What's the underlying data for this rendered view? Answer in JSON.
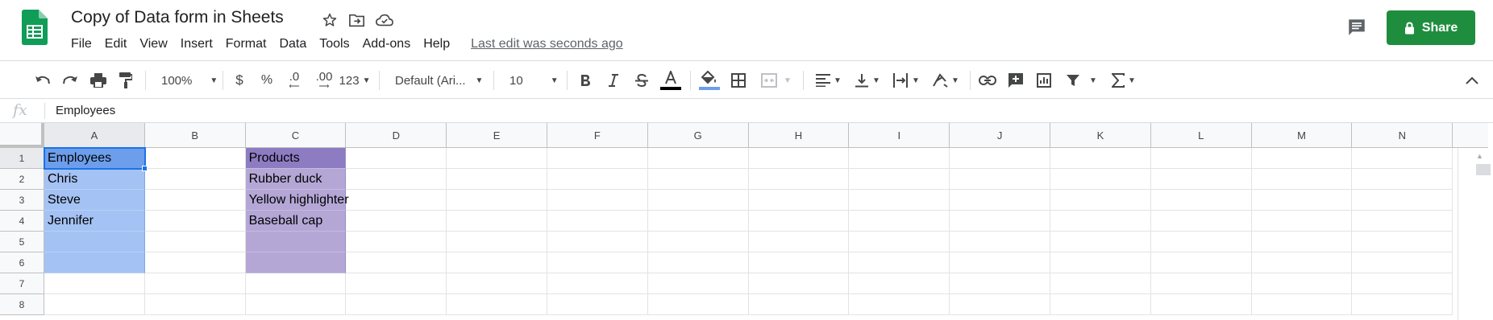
{
  "header": {
    "title": "Copy of Data form in Sheets",
    "last_edit": "Last edit was seconds ago",
    "share_label": "Share",
    "menu": [
      "File",
      "Edit",
      "View",
      "Insert",
      "Format",
      "Data",
      "Tools",
      "Add-ons",
      "Help"
    ]
  },
  "toolbar": {
    "zoom": "100%",
    "currency": "$",
    "percent": "%",
    "dec_decrease": ".0",
    "dec_increase": ".00",
    "more_formats": "123",
    "font": "Default (Ari...",
    "font_size": "10",
    "text_color": "#000000",
    "fill_color": "#6d9eeb"
  },
  "formula_bar": {
    "fx": "fx",
    "content": "Employees"
  },
  "grid": {
    "columns": [
      "A",
      "B",
      "C",
      "D",
      "E",
      "F",
      "G",
      "H",
      "I",
      "J",
      "K",
      "L",
      "M",
      "N"
    ],
    "rows": [
      "1",
      "2",
      "3",
      "4",
      "5",
      "6",
      "7",
      "8"
    ],
    "employees": [
      "Employees",
      "Chris",
      "Steve",
      "Jennifer",
      "",
      ""
    ],
    "products": [
      "Products",
      "Rubber duck",
      "Yellow highlighter",
      "Baseball cap",
      "",
      ""
    ]
  },
  "colors": {
    "brand_green": "#1e8e3e",
    "employee_header": "#6d9eeb",
    "employee_fill": "#a4c2f4",
    "product_header": "#8e7cc3",
    "product_fill": "#b4a7d6",
    "selection": "#1a73e8"
  }
}
